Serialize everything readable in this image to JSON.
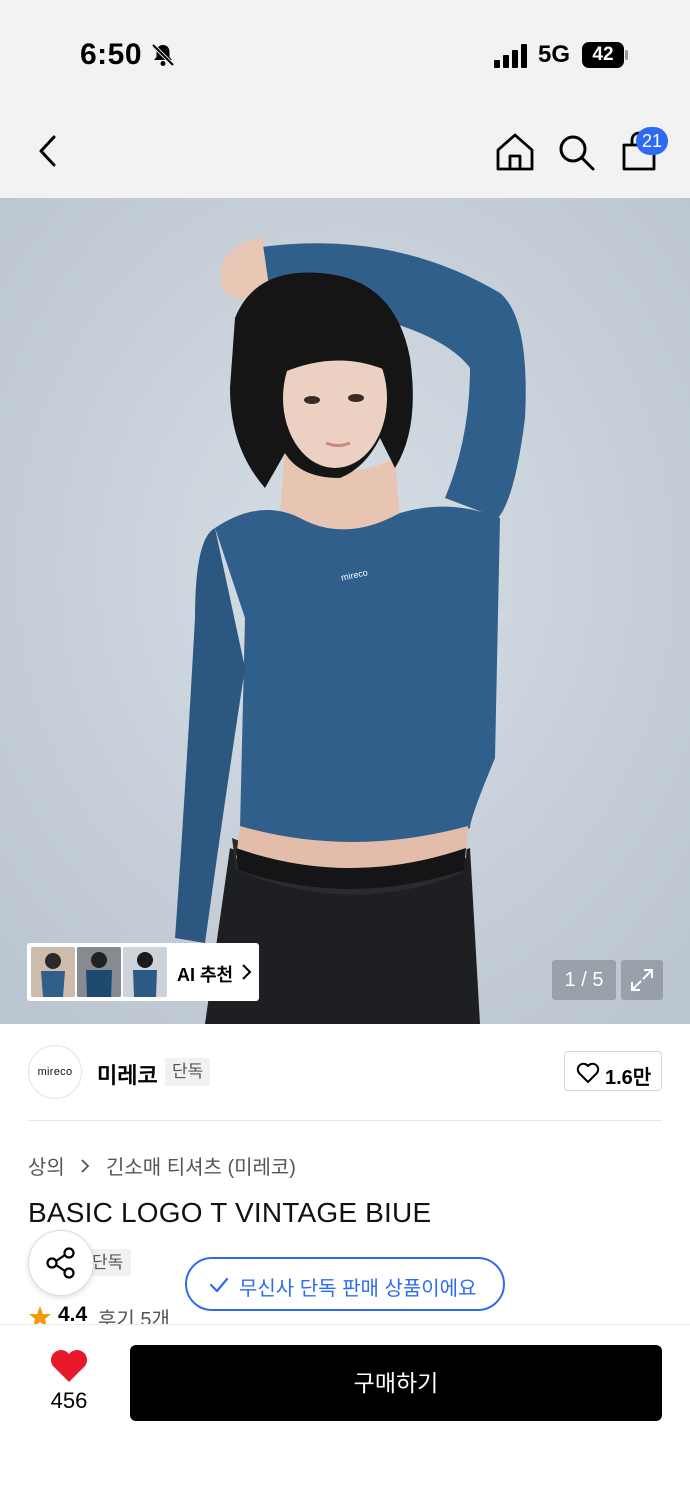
{
  "status_bar": {
    "time": "6:50",
    "network": "5G",
    "battery": "42"
  },
  "nav": {
    "cart_badge": "21"
  },
  "hero": {
    "ai_label": "AI 추천",
    "pager": "1 / 5",
    "shirt_print": "mireco"
  },
  "brand": {
    "logo_text": "mireco",
    "name": "미레코",
    "exclusive_tag": "단독",
    "like_count": "1.6만"
  },
  "breadcrumb": {
    "category": "상의",
    "subcategory": "긴소매 티셔츠 (미레코)"
  },
  "product": {
    "title": "BASIC LOGO T VINTAGE BIUE",
    "exclusive_tag": "단독",
    "exclusive_notice": "무신사 단독 판매 상품이에요",
    "rating": "4.4",
    "review_text": "후기 5개"
  },
  "bottom_bar": {
    "wish_count": "456",
    "buy_label": "구매하기"
  },
  "colors": {
    "accent_blue": "#2f6bf2",
    "heart_red": "#e8182b",
    "shirt_blue": "#2f5f8a",
    "star": "#f39c12"
  }
}
